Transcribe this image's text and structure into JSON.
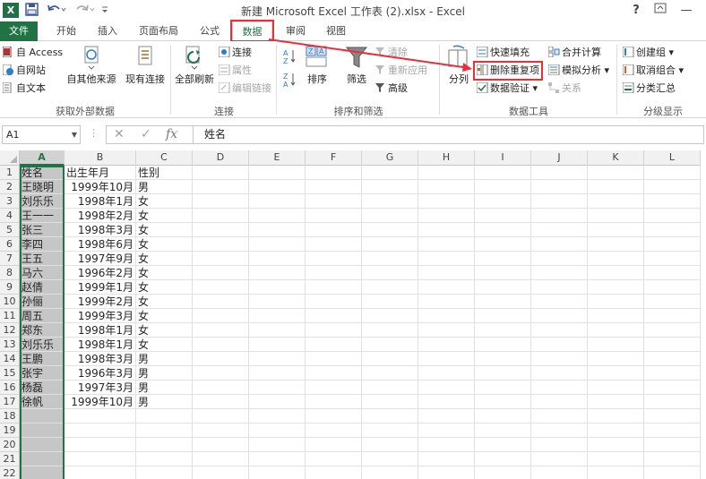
{
  "window": {
    "title": "新建 Microsoft Excel 工作表 (2).xlsx - Excel",
    "logo": "X",
    "help": "?",
    "restore_icon": "↕",
    "minimize": "—"
  },
  "quick_access": {
    "save_icon": "save-icon",
    "undo_icon": "undo-icon",
    "redo_icon": "redo-icon",
    "customize_icon": "customize-icon"
  },
  "tabs": [
    "文件",
    "开始",
    "插入",
    "页面布局",
    "公式",
    "数据",
    "审阅",
    "视图"
  ],
  "active_tab": "数据",
  "ribbon": {
    "get_external": {
      "label": "获取外部数据",
      "access": "自 Access",
      "web": "自网站",
      "text": "自文本",
      "other": "自其他来源",
      "existing": "现有连接"
    },
    "connections": {
      "label": "连接",
      "refresh_all": "全部刷新",
      "connections": "连接",
      "properties": "属性",
      "edit_links": "编辑链接"
    },
    "sort_filter": {
      "label": "排序和筛选",
      "sort": "排序",
      "filter": "筛选",
      "clear": "清除",
      "reapply": "重新应用",
      "advanced": "高级"
    },
    "data_tools": {
      "label": "数据工具",
      "split": "分列",
      "flash_fill": "快速填充",
      "remove_duplicates": "删除重复项",
      "validation": "数据验证",
      "consolidate": "合并计算",
      "what_if": "模拟分析",
      "relationships": "关系"
    },
    "outline": {
      "label": "分级显示",
      "group": "创建组",
      "ungroup": "取消组合",
      "subtotal": "分类汇总"
    }
  },
  "formula_bar": {
    "name_box": "A1",
    "formula": "姓名",
    "fx": "fx"
  },
  "columns": [
    "A",
    "B",
    "C",
    "D",
    "E",
    "F",
    "G",
    "H",
    "I",
    "J",
    "K",
    "L"
  ],
  "selected_column": "A",
  "rows": [
    [
      "姓名",
      "出生年月",
      "性别"
    ],
    [
      "王晓明",
      "1999年10月",
      "男"
    ],
    [
      "刘乐乐",
      "1998年1月",
      "女"
    ],
    [
      "王一一",
      "1998年2月",
      "女"
    ],
    [
      "张三",
      "1998年3月",
      "女"
    ],
    [
      "李四",
      "1998年6月",
      "女"
    ],
    [
      "王五",
      "1997年9月",
      "女"
    ],
    [
      "马六",
      "1996年2月",
      "女"
    ],
    [
      "赵倩",
      "1999年1月",
      "女"
    ],
    [
      "孙俪",
      "1999年2月",
      "女"
    ],
    [
      "周五",
      "1999年3月",
      "女"
    ],
    [
      "郑东",
      "1998年1月",
      "女"
    ],
    [
      "刘乐乐",
      "1998年1月",
      "女"
    ],
    [
      "王鹏",
      "1998年3月",
      "男"
    ],
    [
      "张宇",
      "1996年3月",
      "男"
    ],
    [
      "杨磊",
      "1997年3月",
      "男"
    ],
    [
      "徐帆",
      "1999年10月",
      "男"
    ]
  ],
  "row_numbers": [
    "1",
    "2",
    "3",
    "4",
    "5",
    "6",
    "7",
    "8",
    "9",
    "10",
    "11",
    "12",
    "13",
    "14",
    "15",
    "16",
    "17",
    "18",
    "19",
    "20",
    "21",
    "22"
  ],
  "colors": {
    "accent": "#217346",
    "highlight": "#e8303a",
    "selected_column": "#c6c6c6"
  }
}
